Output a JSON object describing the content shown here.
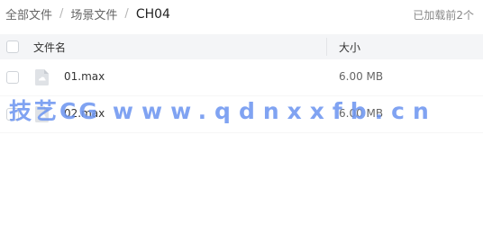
{
  "breadcrumb": {
    "items": [
      "全部文件",
      "场景文件",
      "CH04"
    ],
    "separator": "/"
  },
  "status": {
    "loaded_text": "已加载前2个"
  },
  "table": {
    "headers": {
      "name": "文件名",
      "size": "大小"
    },
    "rows": [
      {
        "name": "01.max",
        "size": "6.00 MB",
        "icon": "file-icon"
      },
      {
        "name": "02.max",
        "size": "6.00 MB",
        "icon": "file-icon"
      }
    ]
  },
  "watermark": {
    "brand": "技艺CG",
    "url": "www.qdnxxfb.cn",
    "color": "#6e96f0"
  },
  "colors": {
    "header_bg": "#f4f5f7",
    "checkbox_border": "#cfd3d8",
    "file_icon": "#d9dce1"
  }
}
